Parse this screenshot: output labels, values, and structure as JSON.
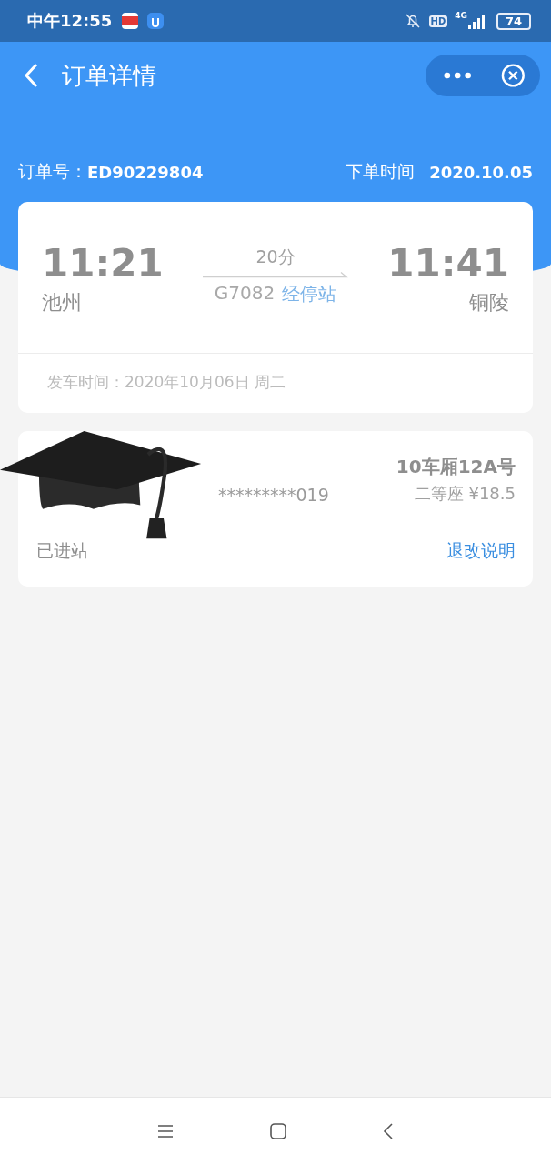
{
  "status_bar": {
    "time": "中午12:55",
    "hd": "HD",
    "network": "4G",
    "battery": "74"
  },
  "nav": {
    "title": "订单详情"
  },
  "order": {
    "label": "订单号：",
    "number": "ED90229804",
    "time_label": "下单时间",
    "date": "2020.10.05"
  },
  "trip": {
    "depart_time": "11:21",
    "depart_station": "池州",
    "duration": "20分",
    "train": "G7082",
    "stops_link": "经停站",
    "arrive_time": "11:41",
    "arrive_station": "铜陵",
    "departure_date": "发车时间：2020年10月06日 周二"
  },
  "passenger": {
    "id_number": "*********019",
    "seat": "10车厢12A号",
    "seat_class": "二等座 ¥18.5",
    "status": "已进站",
    "rules_link": "退改说明"
  }
}
